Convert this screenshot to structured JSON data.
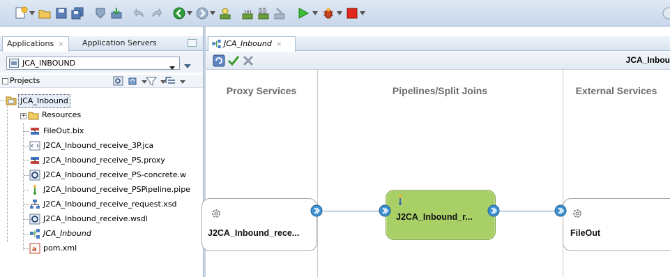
{
  "left_panel": {
    "tabs": [
      {
        "label": "Applications",
        "close": "×"
      },
      {
        "label": "Application Servers",
        "close": ""
      }
    ],
    "application": {
      "selected": "JCA_INBOUND"
    },
    "projects_label": "Projects",
    "tree": {
      "root": "JCA_Inbound",
      "items": [
        {
          "label": "Resources",
          "icon": "folder-icon"
        },
        {
          "label": "FileOut.bix",
          "icon": "business-service-icon"
        },
        {
          "label": "J2CA_Inbound_receive_3P.jca",
          "icon": "jca-file-icon"
        },
        {
          "label": "J2CA_Inbound_receive_PS.proxy",
          "icon": "proxy-service-icon"
        },
        {
          "label": "J2CA_Inbound_receive_PS-concrete.w",
          "icon": "wsdl-icon"
        },
        {
          "label": "J2CA_Inbound_receive_PSPipeline.pipe",
          "icon": "pipeline-icon"
        },
        {
          "label": "J2CA_Inbound_receive_request.xsd",
          "icon": "xsd-icon"
        },
        {
          "label": "J2CA_Inbound_receive.wsdl",
          "icon": "wsdl-icon"
        },
        {
          "label": "JCA_Inbound",
          "icon": "composite-icon",
          "italic": true
        },
        {
          "label": "pom.xml",
          "icon": "maven-icon"
        }
      ]
    }
  },
  "editor": {
    "tab": {
      "label": "JCA_Inbound",
      "close": "×"
    },
    "title": "JCA_Inbou",
    "lanes": [
      "Proxy Services",
      "Pipelines/Split Joins",
      "External Services"
    ],
    "components": {
      "proxy": "J2CA_Inbound_rece...",
      "pipeline": "J2CA_Inbound_r...",
      "external": "FileOut"
    }
  },
  "colors": {
    "toolbar": "#c8d7ea",
    "pipeline_fill": "#a9cf67",
    "lane_header": "#6b6b6b"
  }
}
